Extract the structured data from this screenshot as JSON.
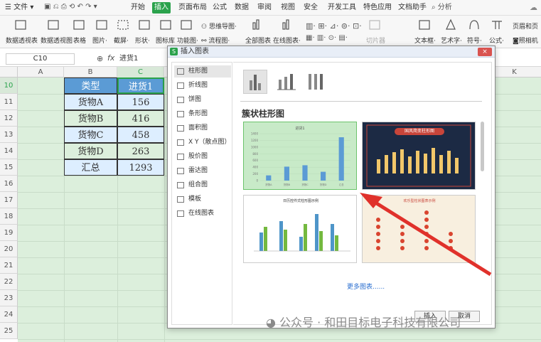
{
  "menu": {
    "file": "文件",
    "items": [
      "开始",
      "插入",
      "页面布局",
      "公式",
      "数据",
      "审阅",
      "视图",
      "安全",
      "开发工具",
      "特色应用",
      "文档助手"
    ],
    "active": "插入",
    "search": "分析"
  },
  "ribbon": {
    "groups": [
      {
        "label": "数据透视表"
      },
      {
        "label": "数据透视图"
      },
      {
        "label": "表格"
      },
      {
        "label": "图片·"
      },
      {
        "label": "截屏·"
      },
      {
        "label": "形状·"
      },
      {
        "label": "图标库"
      },
      {
        "label": "功能图·"
      },
      {
        "label": "全部图表"
      },
      {
        "label": "在线图表·"
      },
      {
        "label": "切片器"
      },
      {
        "label": "文本框·"
      },
      {
        "label": "艺术字·"
      },
      {
        "label": "符号·"
      },
      {
        "label": "公式·"
      }
    ],
    "mindmap": "思维导图·",
    "flowchart": "流程图·",
    "header_footer": "页眉和页",
    "camera": "照相机"
  },
  "formula": {
    "cell_ref": "C10",
    "fx": "fx",
    "value": "进货1"
  },
  "sheet": {
    "col_headers": [
      "A",
      "B",
      "C",
      "",
      "",
      "",
      "",
      "",
      "",
      "",
      "",
      "",
      "K"
    ],
    "rows": [
      "10",
      "11",
      "12",
      "13",
      "14",
      "15",
      "16",
      "17",
      "18",
      "19",
      "20",
      "21",
      "22",
      "23",
      "24",
      "25"
    ],
    "table": {
      "header": [
        "类型",
        "进货1"
      ],
      "data": [
        [
          "货物A",
          "156"
        ],
        [
          "货物B",
          "416"
        ],
        [
          "货物C",
          "458"
        ],
        [
          "货物D",
          "263"
        ],
        [
          "汇总",
          "1293"
        ]
      ]
    }
  },
  "dialog": {
    "title": "插入图表",
    "close": "×",
    "categories": [
      "柱形图",
      "折线图",
      "饼图",
      "条形图",
      "面积图",
      "X Y（散点图）",
      "股价图",
      "雷达图",
      "组合图",
      "模板",
      "在线图表"
    ],
    "selected": "柱形图",
    "section_title": "簇状柱形图",
    "more": "更多图表......",
    "insert_btn": "插入",
    "cancel_btn": "取消",
    "thumb2_title": "国风简变柱形图",
    "thumb3_title": "日历控件式柱形图示例",
    "thumb4_title": "欢乐型柱状图表示例"
  },
  "chart_data": {
    "type": "bar",
    "title": "进货1",
    "categories": [
      "货物A",
      "货物B",
      "货物C",
      "货物D",
      "汇总"
    ],
    "values": [
      156,
      416,
      458,
      263,
      1293
    ],
    "ylim": [
      0,
      1400
    ]
  },
  "watermark": "公众号 · 和田目标电子科技有限公司",
  "colors": {
    "accent": "#2ba24c",
    "bar": "#5b9bd5",
    "header_fill": "#5b9bd5",
    "row_fill": "#ddeeff",
    "arrow": "#e0312b"
  }
}
